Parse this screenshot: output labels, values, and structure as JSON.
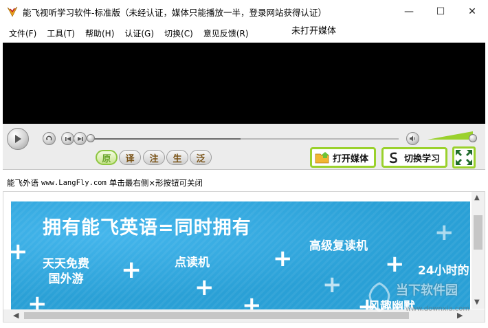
{
  "window": {
    "title": "能飞视听学习软件-标准版（未经认证，媒体只能播放一半，登录网站获得认证）",
    "minimize_glyph": "—",
    "maximize_glyph": "☐",
    "close_glyph": "✕"
  },
  "menu": {
    "items": [
      "文件(F)",
      "工具(T)",
      "帮助(H)",
      "认证(G)",
      "切换(C)",
      "意见反馈(R)"
    ],
    "media_status": "未打开媒体"
  },
  "controls": {
    "progress": 0.0,
    "volume": 1.0,
    "modes": [
      "原",
      "译",
      "注",
      "生",
      "泛"
    ],
    "active_mode": "原",
    "open_media_label": "打开媒体",
    "switch_study_label": "切换学习"
  },
  "info": {
    "prefix": "能飞外语",
    "url": "www.LangFly.com",
    "hint": "单击最右侧×形按钮可关闭"
  },
  "banner": {
    "headline": "拥有能飞英语=同时拥有",
    "feature_1_line1": "天天免费",
    "feature_1_line2": "国外游",
    "feature_2": "点读机",
    "feature_3": "高级复读机",
    "feature_4": "24小时的",
    "feature_5": "风趣幽默"
  },
  "colors": {
    "accent_green": "#9ad12c",
    "banner_blue": "#2aa0d6",
    "video_bg": "#000000"
  },
  "watermark": {
    "line1": "当下软件园",
    "line2": "www.downxia.com"
  }
}
